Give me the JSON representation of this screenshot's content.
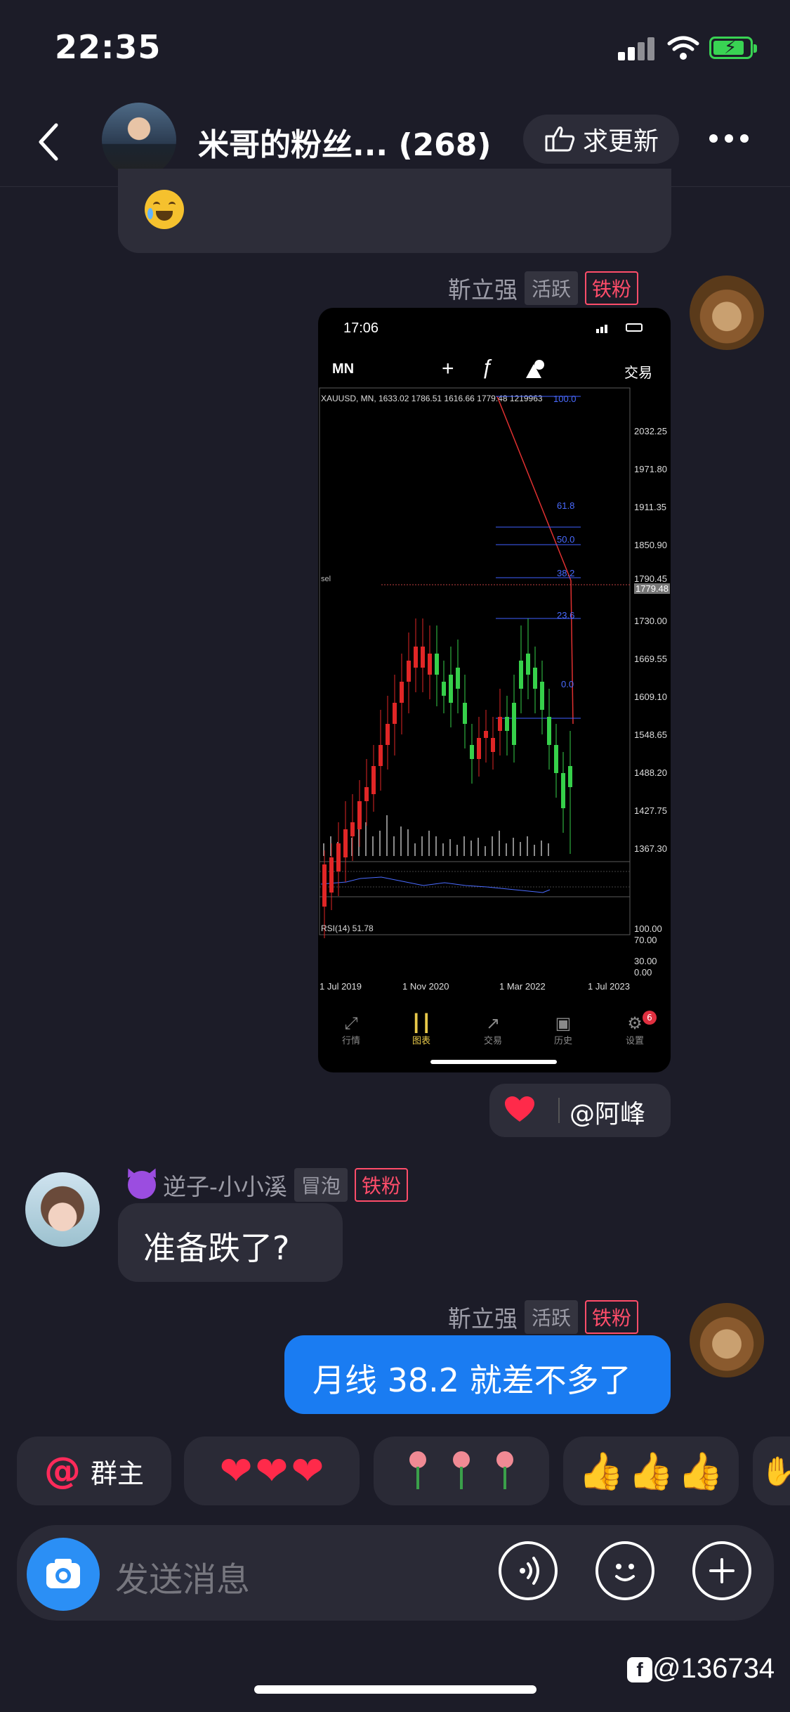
{
  "status_bar": {
    "time": "22:35"
  },
  "header": {
    "group_title": "米哥的粉丝... (268)",
    "update_button": "求更新"
  },
  "messages": [
    {
      "sender": "靳立强",
      "activity_tag": "活跃",
      "fan_tag": "铁粉",
      "type": "image",
      "screenshot": {
        "time": "17:06",
        "period": "MN",
        "trade_label": "交易",
        "ohlc_header": "XAUUSD, MN, 1633.02 1786.51 1616.66 1779.48 1219963",
        "sell_label": "sel",
        "price_ticks": [
          "2032.25",
          "1971.80",
          "1911.35",
          "1850.90",
          "1790.45",
          "1730.00",
          "1669.55",
          "1609.10",
          "1548.65",
          "1488.20",
          "1427.75",
          "1367.30"
        ],
        "current_price": "1779.48",
        "fib_levels": [
          "100.0",
          "61.8",
          "50.0",
          "38.2",
          "23.6",
          "0.0"
        ],
        "rsi_label": "RSI(14) 51.78",
        "rsi_ticks": [
          "100.00",
          "70.00",
          "30.00",
          "0.00"
        ],
        "date_ticks": [
          "1 Jul 2019",
          "1 Nov 2020",
          "1 Mar 2022",
          "1 Jul 2023"
        ],
        "tabs": [
          "行情",
          "图表",
          "交易",
          "历史",
          "设置"
        ],
        "settings_badge": "6"
      },
      "reaction": {
        "mention": "@阿峰"
      }
    },
    {
      "sender": "逆子-小小溪",
      "activity_tag": "冒泡",
      "fan_tag": "铁粉",
      "text": "准备跌了?"
    },
    {
      "sender": "靳立强",
      "activity_tag": "活跃",
      "fan_tag": "铁粉",
      "text": "月线 38.2 就差不多了"
    }
  ],
  "quick_replies": {
    "at_owner": "群主"
  },
  "input": {
    "placeholder": "发送消息"
  },
  "watermark": "@136734",
  "colors": {
    "accent_blue": "#1a7cf2",
    "fan_red": "#ff4d6a",
    "background": "#1c1c28"
  }
}
